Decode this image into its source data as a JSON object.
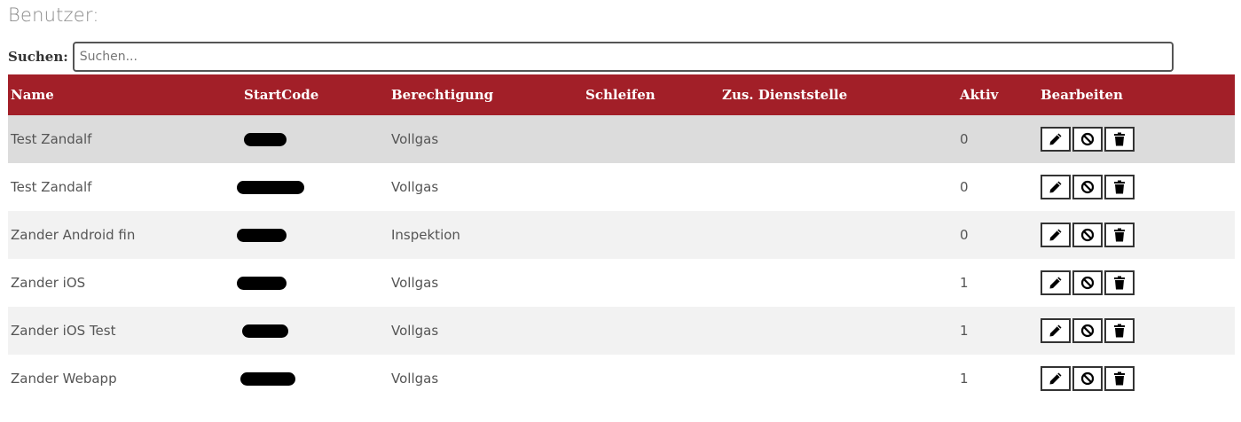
{
  "page": {
    "title": "Benutzer:"
  },
  "search": {
    "label": "Suchen:",
    "placeholder": "Suchen...",
    "value": ""
  },
  "table": {
    "headers": {
      "name": "Name",
      "startcode": "StartCode",
      "berechtigung": "Berechtigung",
      "schleifen": "Schleifen",
      "dienststelle": "Zus. Dienststelle",
      "aktiv": "Aktiv",
      "bearbeiten": "Bearbeiten"
    },
    "rows": [
      {
        "name": "Test Zandalf",
        "startcode": "[redacted]",
        "berechtigung": "Vollgas",
        "schleifen": "",
        "dienststelle": "",
        "aktiv": "0"
      },
      {
        "name": "Test Zandalf",
        "startcode": "[redacted]",
        "berechtigung": "Vollgas",
        "schleifen": "",
        "dienststelle": "",
        "aktiv": "0"
      },
      {
        "name": "Zander Android fin",
        "startcode": "[redacted]",
        "berechtigung": "Inspektion",
        "schleifen": "",
        "dienststelle": "",
        "aktiv": "0"
      },
      {
        "name": "Zander iOS",
        "startcode": "[redacted]",
        "berechtigung": "Vollgas",
        "schleifen": "",
        "dienststelle": "",
        "aktiv": "1"
      },
      {
        "name": "Zander iOS Test",
        "startcode": "[redacted]",
        "berechtigung": "Vollgas",
        "schleifen": "",
        "dienststelle": "",
        "aktiv": "1"
      },
      {
        "name": "Zander Webapp",
        "startcode": "[redacted]",
        "berechtigung": "Vollgas",
        "schleifen": "",
        "dienststelle": "",
        "aktiv": "1"
      }
    ],
    "action_icons": [
      "pencil-icon",
      "ban-icon",
      "trash-icon"
    ]
  },
  "colors": {
    "header_bg": "#a21f28",
    "header_text": "#ffffff",
    "row_odd": "#f2f2f2",
    "row_hover": "#dcdcdc"
  }
}
